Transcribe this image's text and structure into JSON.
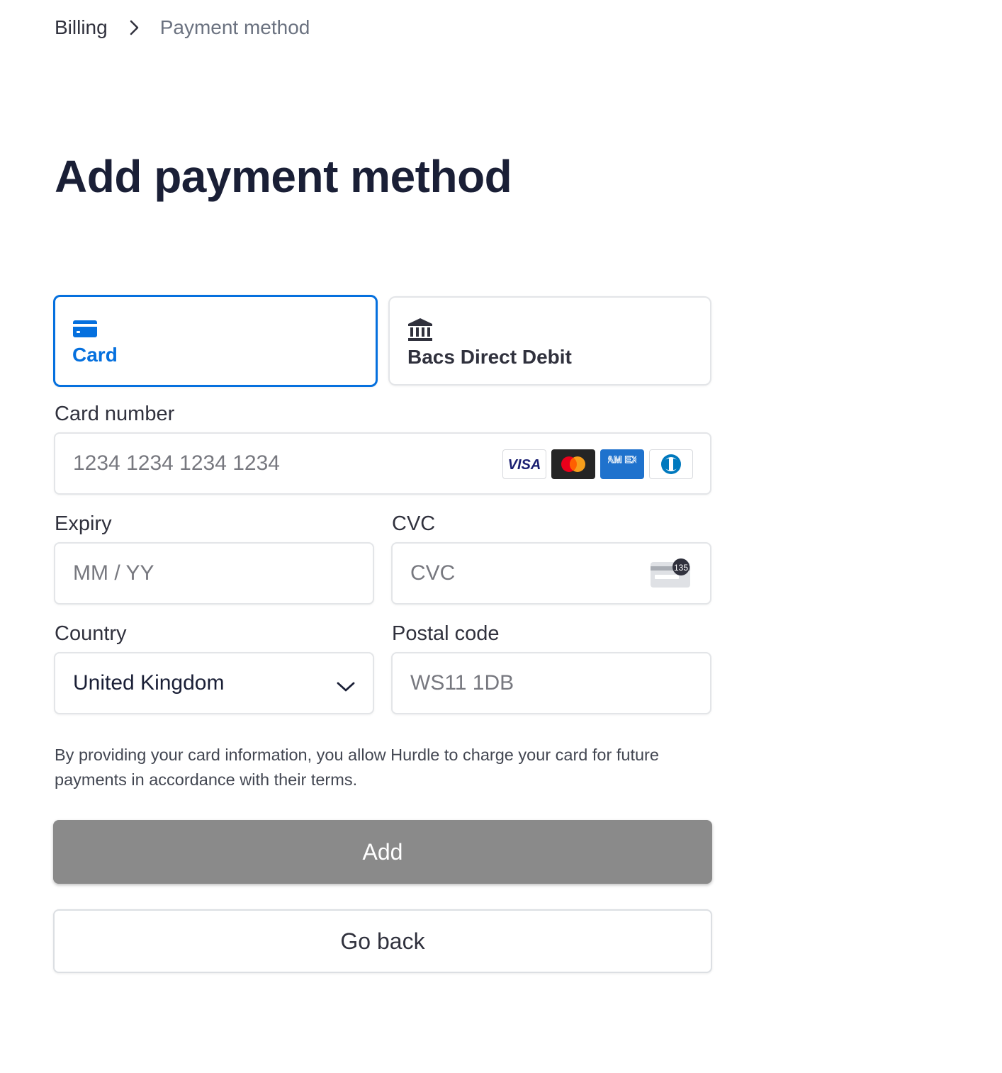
{
  "breadcrumb": {
    "root": "Billing",
    "current": "Payment method"
  },
  "page": {
    "title": "Add payment method"
  },
  "tabs": [
    {
      "label": "Card",
      "icon": "credit-card-icon",
      "selected": true
    },
    {
      "label": "Bacs Direct Debit",
      "icon": "bank-icon",
      "selected": false
    }
  ],
  "card_number": {
    "label": "Card number",
    "placeholder": "1234 1234 1234 1234",
    "brands": [
      "VISA",
      "AM EX"
    ]
  },
  "expiry": {
    "label": "Expiry",
    "placeholder": "MM / YY"
  },
  "cvc": {
    "label": "CVC",
    "placeholder": "CVC",
    "icon_text": "135"
  },
  "country": {
    "label": "Country",
    "value": "United Kingdom"
  },
  "postal_code": {
    "label": "Postal code",
    "placeholder": "WS11 1DB"
  },
  "terms": "By providing your card information, you allow Hurdle to charge your card for future payments in accordance with their terms.",
  "buttons": {
    "add": "Add",
    "back": "Go back"
  },
  "colors": {
    "accent": "#0570de",
    "add_button": "#8a8a8a",
    "title": "#1a1f36"
  }
}
